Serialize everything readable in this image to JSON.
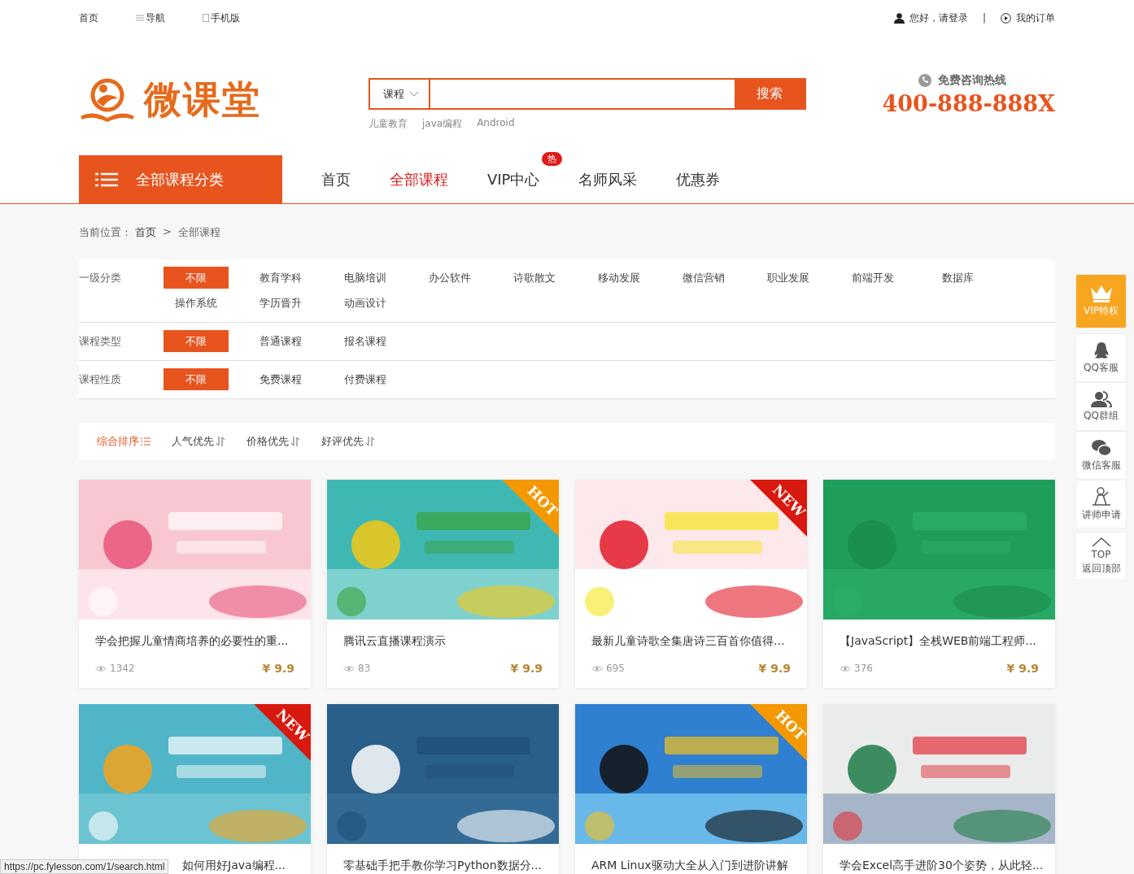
{
  "topbar": {
    "links": [
      {
        "label": "首页",
        "kind": "plain"
      },
      {
        "label": "导航",
        "kind": "menu"
      },
      {
        "label": "手机版",
        "kind": "mobile"
      }
    ],
    "login": "您好，请登录",
    "divider": "|",
    "orders": "我的订单"
  },
  "logo": {
    "text": "微课堂"
  },
  "search": {
    "category": "课程",
    "button": "搜索",
    "hot": [
      "儿童教育",
      "java编程",
      "Android"
    ]
  },
  "hotline": {
    "label": "免费咨询热线",
    "number": "400-888-888X"
  },
  "nav": {
    "all_categories": "全部课程分类",
    "items": [
      {
        "label": "首页",
        "selected": false
      },
      {
        "label": "全部课程",
        "selected": true
      },
      {
        "label": "VIP中心",
        "selected": false,
        "badge": "热"
      },
      {
        "label": "名师风采",
        "selected": false
      },
      {
        "label": "优惠券",
        "selected": false
      }
    ]
  },
  "breadcrumb": {
    "prefix": "当前位置：",
    "home": "首页",
    "separator": ">",
    "current": "全部课程"
  },
  "filters": [
    {
      "label": "一级分类",
      "options": [
        {
          "label": "不限",
          "selected": true
        },
        {
          "label": "教育学科",
          "selected": false
        },
        {
          "label": "电脑培训",
          "selected": false
        },
        {
          "label": "办公软件",
          "selected": false
        },
        {
          "label": "诗歌散文",
          "selected": false
        },
        {
          "label": "移动发展",
          "selected": false
        },
        {
          "label": "微信营销",
          "selected": false
        },
        {
          "label": "职业发展",
          "selected": false
        },
        {
          "label": "前端开发",
          "selected": false
        },
        {
          "label": "数据库",
          "selected": false
        },
        {
          "label": "操作系统",
          "selected": false
        },
        {
          "label": "学历晋升",
          "selected": false
        },
        {
          "label": "动画设计",
          "selected": false
        }
      ]
    },
    {
      "label": "课程类型",
      "options": [
        {
          "label": "不限",
          "selected": true
        },
        {
          "label": "普通课程",
          "selected": false
        },
        {
          "label": "报名课程",
          "selected": false
        }
      ]
    },
    {
      "label": "课程性质",
      "options": [
        {
          "label": "不限",
          "selected": true
        },
        {
          "label": "免费课程",
          "selected": false
        },
        {
          "label": "付费课程",
          "selected": false
        }
      ]
    }
  ],
  "sort": [
    {
      "label": "综合排序",
      "selected": true
    },
    {
      "label": "人气优先",
      "selected": false
    },
    {
      "label": "价格优先",
      "selected": false
    },
    {
      "label": "好评优先",
      "selected": false
    }
  ],
  "courses": [
    {
      "title": "学会把握儿童情商培养的必要性的重...",
      "views": "1342",
      "price": "¥ 9.9"
    },
    {
      "title": "腾讯云直播课程演示",
      "views": "83",
      "price": "¥ 9.9",
      "tag": "HOT"
    },
    {
      "title": "最新儿童诗歌全集唐诗三百首你值得...",
      "views": "695",
      "price": "¥ 9.9",
      "tag": "NEW"
    },
    {
      "title": "【JavaScript】全栈WEB前端工程师...",
      "views": "376",
      "price": "¥ 9.9"
    },
    {
      "title": "如何用好Java编程...",
      "tag": "NEW"
    },
    {
      "title": "零基础手把手教你学习Python数据分..."
    },
    {
      "title": "ARM Linux驱动大全从入门到进阶讲解",
      "tag": "HOT"
    },
    {
      "title": "学会Excel高手进阶30个姿势，从此轻..."
    }
  ],
  "sidebar": [
    {
      "kind": "vip",
      "label": "VIP特权"
    },
    {
      "kind": "qq",
      "label": "QQ客服"
    },
    {
      "kind": "group",
      "label": "QQ群组"
    },
    {
      "kind": "wechat",
      "label": "微信客服"
    },
    {
      "kind": "teacher",
      "label": "讲师申请"
    },
    {
      "kind": "top",
      "top": "TOP",
      "label": "返回顶部"
    }
  ],
  "status_url": "https://pc.fylesson.com/1/search.html"
}
